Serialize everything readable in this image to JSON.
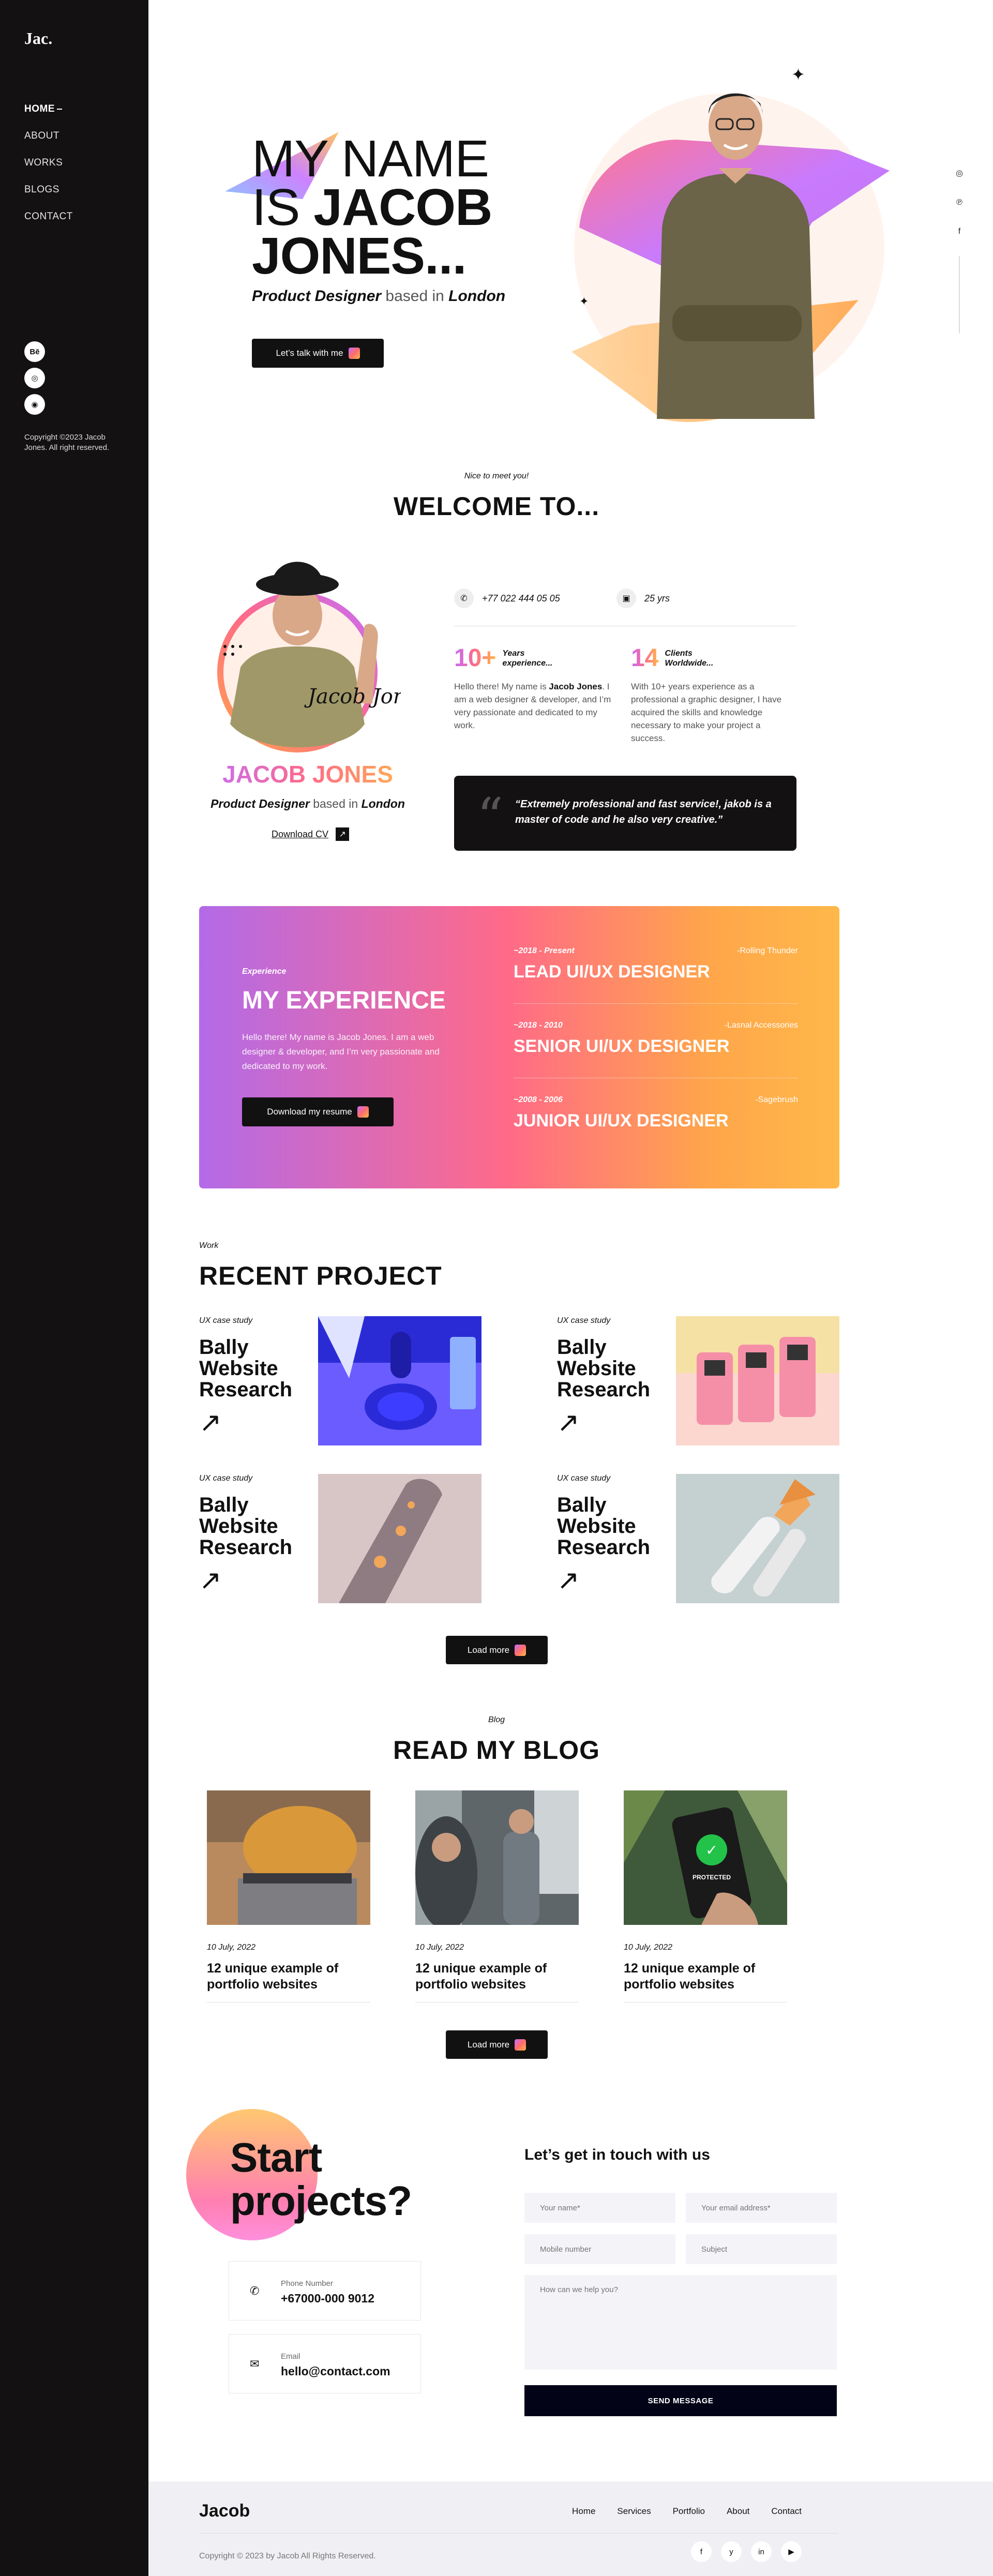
{
  "sidebar": {
    "logo": "Jac.",
    "nav": [
      "HOME",
      "ABOUT",
      "WORKS",
      "BLOGS",
      "CONTACT"
    ],
    "social": [
      "Bē",
      "◎",
      "◉"
    ],
    "copyright": "Copyright ©2023 Jacob Jones. All right reserved."
  },
  "right_social": [
    "◎",
    "℗",
    "f"
  ],
  "hero": {
    "line1": "MY NAME",
    "line2a": "IS ",
    "line2b": "JACOB",
    "line3": "JONES...",
    "sub_role": "Product Designer",
    "sub_mid": " based in ",
    "sub_city": "London",
    "button": "Let’s talk with me"
  },
  "welcome": {
    "tag": "Nice to meet you!",
    "title": "WELCOME TO...",
    "name": "JACOB JONES",
    "role": "Product Designer",
    "mid": " based in ",
    "city": "London",
    "download": "Download CV",
    "phone": "+77 022 444 05 05",
    "age": "25 yrs",
    "stat1": {
      "num": "10+",
      "label1": "Years",
      "label2": "experience...",
      "text_a": "Hello there! My name is ",
      "text_b": "Jacob Jones",
      "text_c": ". I am a web designer & developer, and I’m very passionate and dedicated to my work."
    },
    "stat2": {
      "num": "14",
      "label1": "Clients",
      "label2": "Worldwide...",
      "text": "With 10+ years experience as a professional a graphic designer, I have acquired the skills and knowledge necessary to make your project a success."
    },
    "quote": "“Extremely professional and fast service!, jakob is a master of code and he also very creative.”"
  },
  "experience": {
    "tag": "Experience",
    "title": "MY EXPERIENCE",
    "desc": "Hello there! My name is Jacob Jones. I am a web designer & developer, and I’m very passionate and dedicated to my work.",
    "button": "Download my resume",
    "roles": [
      {
        "years": "~2018 - Present",
        "company": "-Rolling Thunder",
        "title": "LEAD UI/UX DESIGNER"
      },
      {
        "years": "~2018 - 2010",
        "company": "-Lasnal Accessories",
        "title": "SENIOR UI/UX DESIGNER"
      },
      {
        "years": "~2008 - 2006",
        "company": "-Sagebrush",
        "title": "JUNIOR UI/UX DESIGNER"
      }
    ]
  },
  "work": {
    "tag": "Work",
    "title": "RECENT PROJECT",
    "button": "Load more",
    "projects": [
      {
        "type": "UX case study",
        "name": "Bally Website Research"
      },
      {
        "type": "UX case study",
        "name": "Bally Website Research"
      },
      {
        "type": "UX case study",
        "name": "Bally Website Research"
      },
      {
        "type": "UX case study",
        "name": "Bally Website Research"
      }
    ]
  },
  "blog": {
    "tag": "Blog",
    "title": "READ MY BLOG",
    "button": "Load more",
    "img_caption": "PROTECTED",
    "posts": [
      {
        "date": "10 July, 2022",
        "title": "12 unique example of portfolio websites"
      },
      {
        "date": "10 July, 2022",
        "title": "12 unique example of portfolio websites"
      },
      {
        "date": "10 July, 2022",
        "title": "12 unique example of portfolio websites"
      }
    ]
  },
  "contact": {
    "headline1": "Start",
    "headline2": "projects?",
    "phone_label": "Phone Number",
    "phone": "+67000-000 9012",
    "email_label": "Email",
    "email": "hello@contact.com",
    "form_title": "Let’s get in touch with us",
    "placeholders": {
      "name": "Your name*",
      "email": "Your email address*",
      "mobile": "Mobile number",
      "subject": "Subject",
      "message": "How can we help you?"
    },
    "send": "SEND MESSAGE"
  },
  "footer": {
    "name": "Jacob",
    "links": [
      "Home",
      "Services",
      "Portfolio",
      "About",
      "Contact"
    ],
    "copyright": "Copyright © 2023 by Jacob All Rights Reserved.",
    "social": [
      "f",
      "y",
      "in",
      "▶"
    ]
  },
  "colors": {
    "dark": "#141112",
    "grad_start": "#c36cff",
    "grad_mid": "#ff6a88",
    "grad_end": "#ffb84a"
  }
}
